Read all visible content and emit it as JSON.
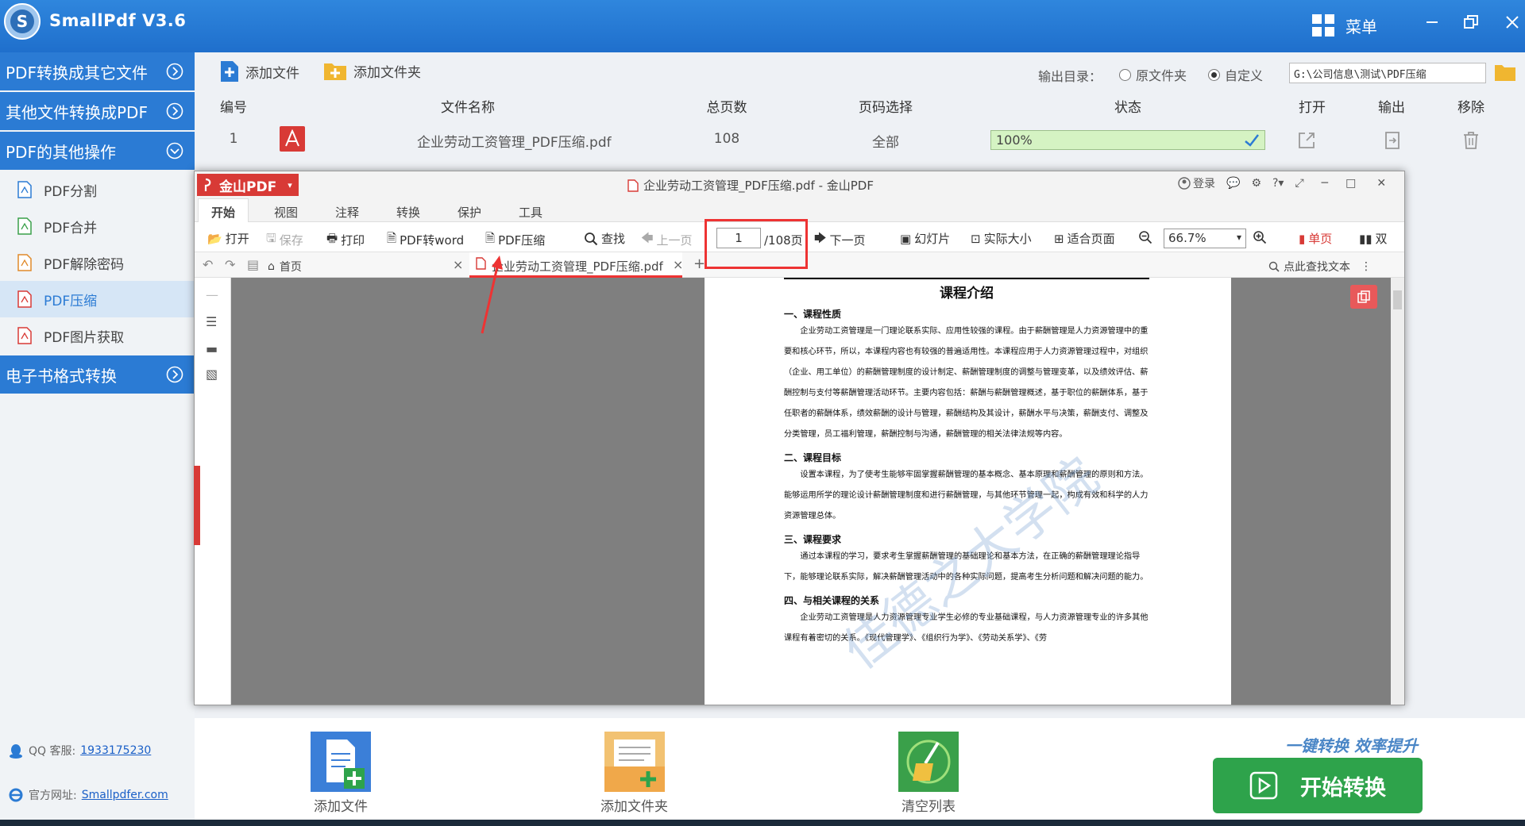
{
  "app": {
    "title": "SmallPdf V3.6",
    "menu_label": "菜单"
  },
  "sidebar": {
    "cat1": "PDF转换成其它文件",
    "cat2": "其他文件转换成PDF",
    "cat3": "PDF的其他操作",
    "items": [
      {
        "label": "PDF分割"
      },
      {
        "label": "PDF合并"
      },
      {
        "label": "PDF解除密码"
      },
      {
        "label": "PDF压缩"
      },
      {
        "label": "PDF图片获取"
      }
    ],
    "cat4": "电子书格式转换",
    "support_label": "QQ 客服:",
    "support_qq": "1933175230",
    "website_label": "官方网址:",
    "website_url": "Smallpdfer.com"
  },
  "toolbar": {
    "add_file": "添加文件",
    "add_folder": "添加文件夹",
    "output_label": "输出目录：",
    "radio_source": "原文件夹",
    "radio_custom": "自定义",
    "output_path": "G:\\公司信息\\测试\\PDF压缩"
  },
  "table": {
    "headers": {
      "index": "编号",
      "filename": "文件名称",
      "pages": "总页数",
      "page_select": "页码选择",
      "status": "状态",
      "open": "打开",
      "output": "输出",
      "remove": "移除"
    },
    "row": {
      "index": "1",
      "filename": "企业劳动工资管理_PDF压缩.pdf",
      "pages": "108",
      "page_select": "全部",
      "status": "100%",
      "progress": 1.0
    }
  },
  "wps": {
    "brand": "金山PDF",
    "title": "企业劳动工资管理_PDF压缩.pdf - 金山PDF",
    "login": "登录",
    "tabs": [
      "开始",
      "视图",
      "注释",
      "转换",
      "保护",
      "工具"
    ],
    "tools": {
      "open": "打开",
      "save": "保存",
      "print": "打印",
      "to_word": "PDF转word",
      "compress": "PDF压缩",
      "find": "查找",
      "prev": "上一页",
      "page": "1",
      "page_total": "/108页",
      "next": "下一页",
      "slideshow": "幻灯片",
      "actual": "实际大小",
      "fit": "适合页面",
      "zoom": "66.7%",
      "single": "单页",
      "double": "双"
    },
    "home_tab": "首页",
    "doc_tab": "企业劳动工资管理_PDF压缩.pdf",
    "find_text": "点此查找文本"
  },
  "doc": {
    "title": "课程介绍",
    "s1": "一、课程性质",
    "p1": "企业劳动工资管理是一门理论联系实际、应用性较强的课程。由于薪酬管理是人力资源管理中的重要和核心环节，所以，本课程内容也有较强的普遍适用性。本课程应用于人力资源管理过程中，对组织（企业、用工单位）的薪酬管理制度的设计制定、薪酬管理制度的调整与管理变革，以及绩效评估、薪酬控制与支付等薪酬管理活动环节。主要内容包括：薪酬与薪酬管理概述，基于职位的薪酬体系，基于任职者的薪酬体系，绩效薪酬的设计与管理，薪酬结构及其设计，薪酬水平与决策，薪酬支付、调整及分类管理，员工福利管理，薪酬控制与沟通，薪酬管理的相关法律法规等内容。",
    "s2": "二、课程目标",
    "p2": "设置本课程，为了使考生能够牢固掌握薪酬管理的基本概念、基本原理和薪酬管理的原则和方法。能够运用所学的理论设计薪酬管理制度和进行薪酬管理，与其他环节管理一起，构成有效和科学的人力资源管理总体。",
    "s3": "三、课程要求",
    "p3": "通过本课程的学习，要求考生掌握薪酬管理的基础理论和基本方法，在正确的薪酬管理理论指导下，能够理论联系实际，解决薪酬管理活动中的各种实际问题，提高考生分析问题和解决问题的能力。",
    "s4": "四、与相关课程的关系",
    "p4": "企业劳动工资管理是人力资源管理专业学生必修的专业基础课程，与人力资源管理专业的许多其他课程有着密切的关系。《现代管理学》、《组织行为学》、《劳动关系学》、《劳",
    "watermark": "佳德之大学院"
  },
  "bottom": {
    "add_file": "添加文件",
    "add_folder": "添加文件夹",
    "clear": "清空列表",
    "slogan": "一键转换  效率提升",
    "start": "开始转换"
  },
  "colors": {
    "brand_blue": "#2b7bd4",
    "wps_red": "#d83a36",
    "start_green": "#2ea34b",
    "progress_green": "#d5f3c3"
  }
}
